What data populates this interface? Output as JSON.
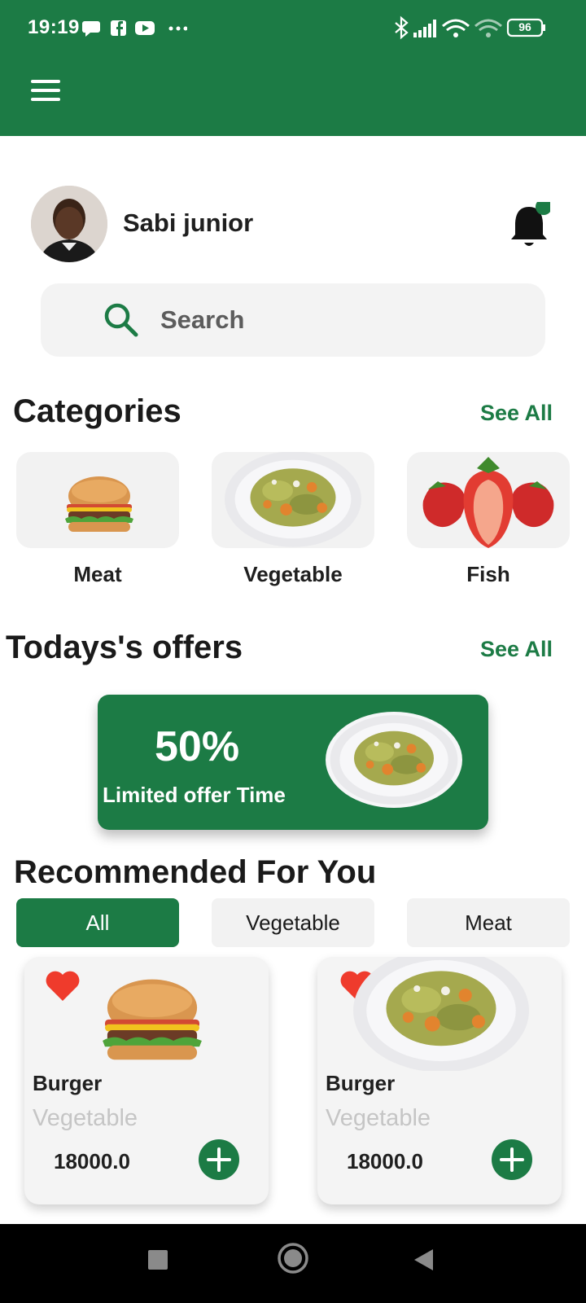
{
  "colors": {
    "primary": "#1c7b45",
    "background": "#ffffff",
    "muted": "#f3f3f3"
  },
  "status_bar": {
    "time": "19:19",
    "battery": "96",
    "icons": [
      "chat-bubble-icon",
      "facebook-icon",
      "youtube-icon",
      "more-dots-icon",
      "bluetooth-icon",
      "signal-icon",
      "wifi-icon",
      "wifi-2-icon",
      "battery-icon"
    ]
  },
  "app_bar": {
    "menu_icon": "hamburger-menu-icon"
  },
  "profile": {
    "name": "Sabi junior",
    "notification_icon": "bell-icon",
    "has_unread": true
  },
  "search": {
    "placeholder": "Search",
    "icon": "search-icon"
  },
  "categories": {
    "title": "Categories",
    "see_all": "See All",
    "items": [
      {
        "label": "Meat",
        "icon": "burger-image"
      },
      {
        "label": "Vegetable",
        "icon": "pasta-plate-image"
      },
      {
        "label": "Fish",
        "icon": "strawberries-image"
      }
    ]
  },
  "offers": {
    "title": "Todays's offers",
    "see_all": "See All",
    "banner": {
      "discount": "50%",
      "caption": "Limited offer Time"
    }
  },
  "recommended": {
    "title": "Recommended For You",
    "filters": [
      {
        "label": "All",
        "active": true
      },
      {
        "label": "Vegetable",
        "active": false
      },
      {
        "label": "Meat",
        "active": false
      }
    ],
    "items": [
      {
        "name": "Burger",
        "category": "Vegetable",
        "price": "18000.0",
        "favorite": true,
        "image": "burger-image"
      },
      {
        "name": "Burger",
        "category": "Vegetable",
        "price": "18000.0",
        "favorite": true,
        "image": "pasta-plate-image"
      }
    ]
  },
  "nav_bar": {
    "buttons": [
      "recents-square-icon",
      "home-circle-icon",
      "back-triangle-icon"
    ]
  }
}
